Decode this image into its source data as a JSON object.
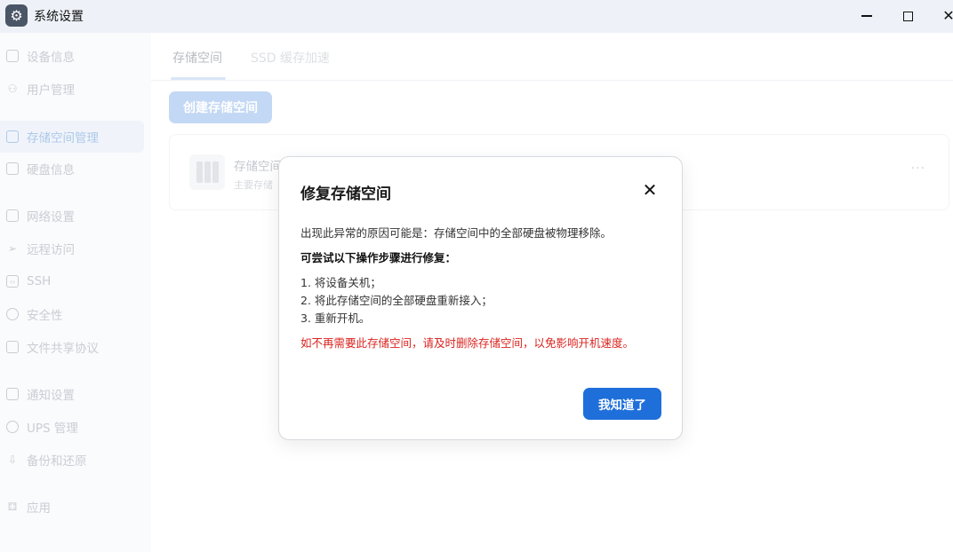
{
  "window": {
    "title": "系统设置",
    "icon": "gear-icon"
  },
  "sidebar": {
    "items": [
      {
        "label": "设备信息",
        "icon": "drive-icon",
        "active": false
      },
      {
        "label": "用户管理",
        "icon": "users-icon",
        "active": false
      },
      {
        "label": "存储空间管理",
        "icon": "storage-icon",
        "active": true
      },
      {
        "label": "硬盘信息",
        "icon": "disk-icon",
        "active": false
      },
      {
        "label": "网络设置",
        "icon": "network-icon",
        "active": false
      },
      {
        "label": "远程访问",
        "icon": "send-icon",
        "active": false
      },
      {
        "label": "SSH",
        "icon": "code-icon",
        "active": false
      },
      {
        "label": "安全性",
        "icon": "shield-icon",
        "active": false
      },
      {
        "label": "文件共享协议",
        "icon": "file-icon",
        "active": false
      },
      {
        "label": "通知设置",
        "icon": "mail-icon",
        "active": false
      },
      {
        "label": "UPS 管理",
        "icon": "ups-icon",
        "active": false
      },
      {
        "label": "备份和还原",
        "icon": "backup-icon",
        "active": false
      },
      {
        "label": "应用",
        "icon": "apps-icon",
        "active": false
      }
    ]
  },
  "main": {
    "tabs": [
      {
        "label": "存储空间",
        "active": true
      },
      {
        "label": "SSD 缓存加速",
        "active": false
      }
    ],
    "create_button": "创建存储空间",
    "pool": {
      "name": "存储空间",
      "subtitle": "主要存储",
      "more": "···"
    }
  },
  "dialog": {
    "title": "修复存储空间",
    "close": "✕",
    "reason": "出现此异常的原因可能是：存储空间中的全部硬盘被物理移除。",
    "steps_title": "可尝试以下操作步骤进行修复：",
    "steps": [
      "1. 将设备关机；",
      "2. 将此存储空间的全部硬盘重新接入；",
      "3. 重新开机。"
    ],
    "warning": "如不再需要此存储空间，请及时删除存储空间，以免影响开机速度。",
    "ok_button": "我知道了"
  },
  "colors": {
    "primary": "#1f6fdb",
    "warning": "#d9241f",
    "disabled_primary": "#c3d8f4"
  }
}
